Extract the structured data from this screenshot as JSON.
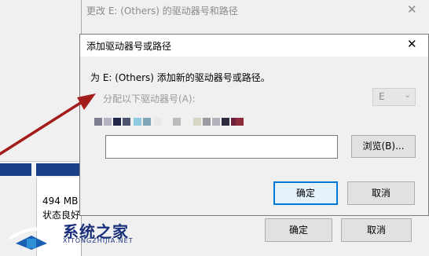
{
  "background": {
    "partition_size": "494 MB",
    "partition_status": "状态良好"
  },
  "outer_dialog": {
    "title": "更改 E: (Others) 的驱动器号和路径",
    "close_glyph": "✕",
    "ok_label": "确定",
    "cancel_label": "取消"
  },
  "inner_dialog": {
    "title": "添加驱动器号或路径",
    "close_glyph": "✕",
    "description": "为 E: (Others) 添加新的驱动器号或路径。",
    "radio_label": "分配以下驱动器号(A):",
    "drive_letter": "E",
    "chevron_glyph": "⌄",
    "path_value": "",
    "browse_label": "浏览(B)...",
    "ok_label": "确定",
    "cancel_label": "取消"
  },
  "watermark": {
    "cn": "系统之家",
    "en": "XITONGZHIJIA.NET"
  },
  "colors": {
    "accent": "#0078d7",
    "arrow": "#a31d1d",
    "disk_bar": "#1b3f86",
    "watermark": "#1a2f7a"
  }
}
